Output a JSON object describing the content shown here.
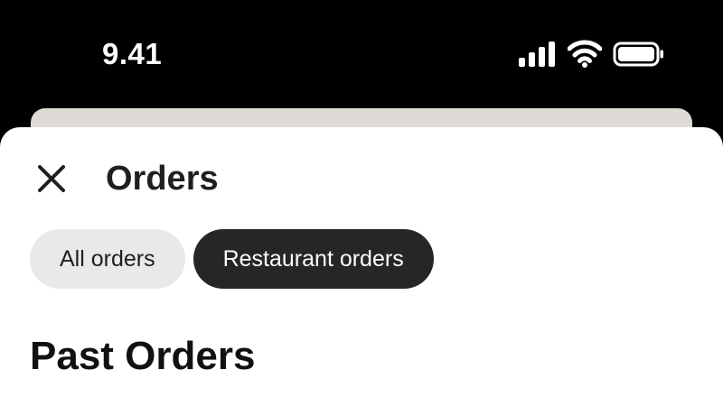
{
  "status_bar": {
    "time": "9.41",
    "icons": [
      "cellular-signal-icon",
      "wifi-icon",
      "battery-icon"
    ]
  },
  "header": {
    "close_icon": "close-icon",
    "title": "Orders"
  },
  "tabs": [
    {
      "label": "All orders",
      "active": false
    },
    {
      "label": "Restaurant orders",
      "active": true
    }
  ],
  "section": {
    "title": "Past Orders"
  },
  "colors": {
    "background": "#000000",
    "sheet": "#ffffff",
    "back_sheet": "#dedbd6",
    "tab_inactive": "#e9e9ea",
    "tab_active": "#262626",
    "text_dark": "#1f1f1f"
  }
}
